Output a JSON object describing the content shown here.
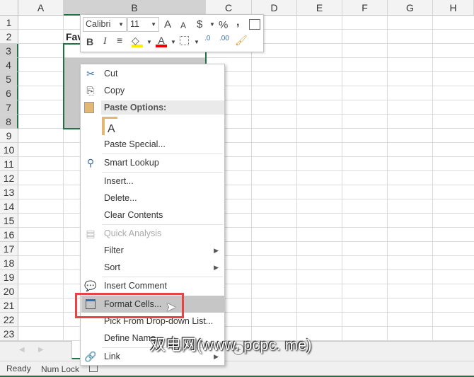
{
  "columns": [
    "A",
    "B",
    "C",
    "D",
    "E",
    "F",
    "G",
    "H"
  ],
  "rows": [
    "1",
    "2",
    "3",
    "4",
    "5",
    "6",
    "7",
    "8",
    "9",
    "10",
    "11",
    "12",
    "13",
    "14",
    "15",
    "16",
    "17",
    "18",
    "19",
    "20",
    "21",
    "22",
    "23"
  ],
  "cells": {
    "B2": "Fav"
  },
  "mini_toolbar": {
    "font": "Calibri",
    "size": "11",
    "grow": "A",
    "shrink": "A",
    "currency": "$",
    "percent": "%",
    "comma": ",",
    "bold": "B",
    "italic": "I",
    "font_color": "A",
    "inc_decimal": ".0",
    "dec_decimal": ".00"
  },
  "menu": {
    "cut": "Cut",
    "copy": "Copy",
    "paste_options": "Paste Options:",
    "paste_glyph": "A",
    "paste_special": "Paste Special...",
    "smart_lookup": "Smart Lookup",
    "insert": "Insert...",
    "delete": "Delete...",
    "clear_contents": "Clear Contents",
    "quick_analysis": "Quick Analysis",
    "filter": "Filter",
    "sort": "Sort",
    "insert_comment": "Insert Comment",
    "format_cells": "Format Cells...",
    "pick_list": "Pick From Drop-down List...",
    "define_name": "Define Name...",
    "link": "Link"
  },
  "status": {
    "ready": "Ready",
    "num_lock": "Num Lock"
  },
  "watermark": "双电网(www. pcpc. me)",
  "colors": {
    "accent": "#217346",
    "highlight": "#e84444"
  }
}
